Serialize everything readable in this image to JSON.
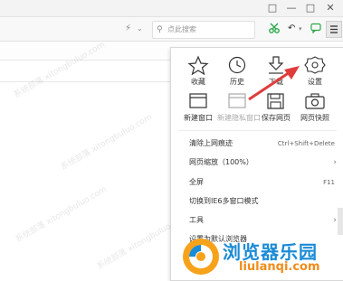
{
  "window": {
    "controls": [
      "□",
      "—",
      "□",
      "✕"
    ]
  },
  "toolbar": {
    "lightning_icon": "⚡",
    "search_placeholder": "点此搜索"
  },
  "menu": {
    "row1": [
      {
        "label": "收藏",
        "icon": "star-icon"
      },
      {
        "label": "历史",
        "icon": "clock-icon"
      },
      {
        "label": "下载",
        "icon": "download-icon"
      },
      {
        "label": "设置",
        "icon": "gear-icon"
      }
    ],
    "row2": [
      {
        "label": "新建窗口",
        "icon": "window-icon"
      },
      {
        "label": "新建隐私窗口",
        "icon": "private-window-icon"
      },
      {
        "label": "保存网页",
        "icon": "save-icon"
      },
      {
        "label": "网页快照",
        "icon": "camera-icon"
      }
    ],
    "items": [
      {
        "label": "清除上网痕迹",
        "shortcut": "Ctrl+Shift+Delete"
      },
      {
        "label": "网页缩放（100%）",
        "shortcut": ""
      },
      {
        "label": "全屏",
        "shortcut": "F11"
      },
      {
        "label": "切换到IE6多窗口模式",
        "shortcut": ""
      },
      {
        "label": "工具",
        "shortcut": ""
      },
      {
        "label": "设置为默认浏览器",
        "shortcut": ""
      },
      {
        "label": "关于",
        "shortcut": ""
      }
    ]
  },
  "watermark": {
    "text": "系统部落 xitongbuluo.com",
    "logo_title": "浏览器乐园",
    "logo_url": "liulanqi.com"
  },
  "colors": {
    "arrow": "#e03c3c",
    "logo_blue": "#1a8bd6",
    "logo_orange": "#f08c1a"
  }
}
